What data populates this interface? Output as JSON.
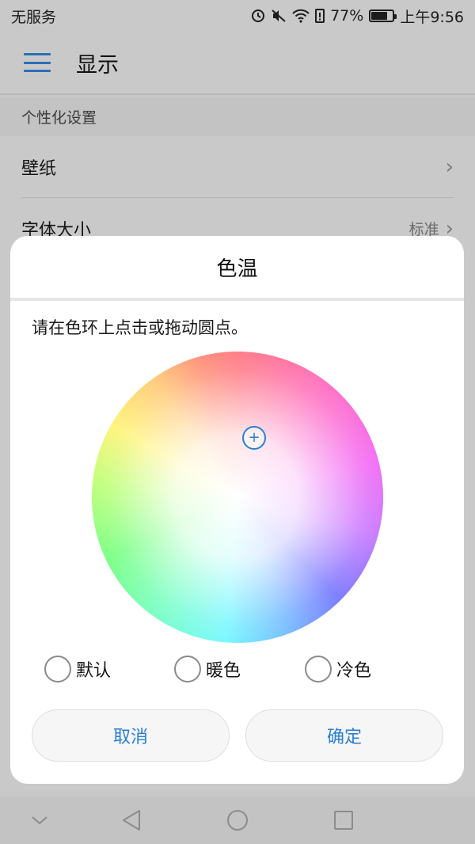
{
  "status_bar": {
    "carrier": "无服务",
    "battery_percent": "77%",
    "battery_level": 0.77,
    "time": "上午9:56"
  },
  "app_bar": {
    "title": "显示",
    "menu_icon": "hamburger-menu-icon"
  },
  "settings": {
    "section_header": "个性化设置",
    "items": [
      {
        "label": "壁纸",
        "value": ""
      },
      {
        "label": "字体大小",
        "value": "标准"
      }
    ]
  },
  "dialog": {
    "title": "色温",
    "message": "请在色环上点击或拖动圆点。",
    "options": [
      {
        "label": "默认"
      },
      {
        "label": "暖色"
      },
      {
        "label": "冷色"
      }
    ],
    "cancel_label": "取消",
    "confirm_label": "确定",
    "accent_color": "#2a7fd4"
  },
  "nav_bar": {
    "icons": [
      "back-icon",
      "home-icon",
      "recents-icon",
      "hide-icon"
    ]
  }
}
